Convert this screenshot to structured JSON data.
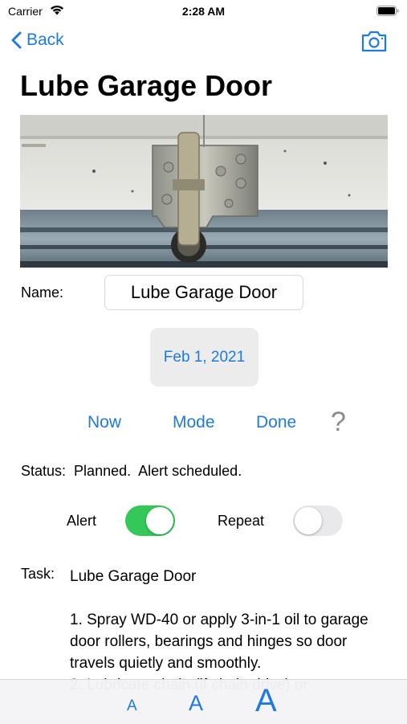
{
  "status_bar": {
    "carrier": "Carrier",
    "time": "2:28 AM"
  },
  "nav": {
    "back_label": "Back"
  },
  "page": {
    "title": "Lube Garage Door"
  },
  "form": {
    "name_label": "Name:",
    "name_value": "Lube Garage Door",
    "date_value": "Feb 1, 2021"
  },
  "actions": {
    "now": "Now",
    "mode": "Mode",
    "done": "Done",
    "help": "?"
  },
  "status": {
    "label": "Status:",
    "value": "Planned.  Alert scheduled."
  },
  "toggles": {
    "alert": {
      "label": "Alert",
      "on": true
    },
    "repeat": {
      "label": "Repeat",
      "on": false
    }
  },
  "task": {
    "label": "Task:",
    "title": "Lube Garage Door",
    "step1": "1. Spray WD-40 or apply 3-in-1 oil to garage door rollers, bearings and hinges so door travels quietly and smoothly.",
    "step2_partial": "2. Lubricate chain (if chain drive) or"
  },
  "font_size_buttons": [
    "A",
    "A",
    "A"
  ],
  "colors": {
    "accent": "#1f7ae0",
    "toggle_on": "#34c759",
    "toggle_off": "#e9e9eb"
  }
}
